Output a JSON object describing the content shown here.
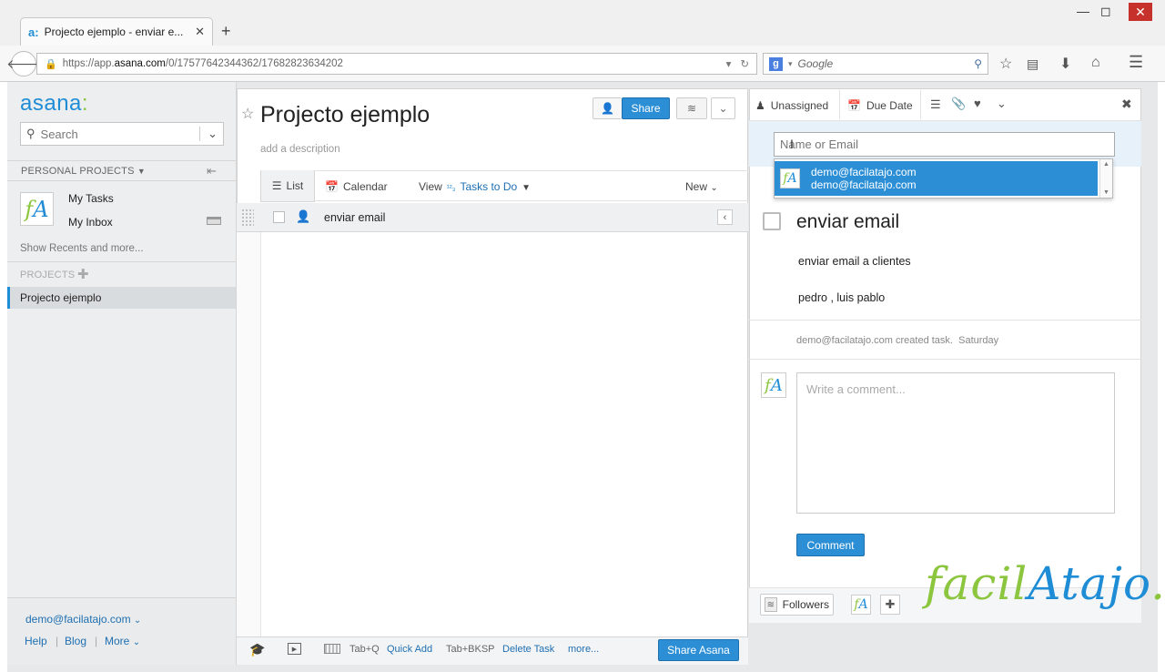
{
  "browser": {
    "tab_title": "Projecto ejemplo - enviar e...",
    "tab_favicon": "a:",
    "url_prefix": "https://app.",
    "url_domain": "asana.com",
    "url_path": "/0/17577642344362/17682823634202",
    "search_engine_placeholder": "Google",
    "new_tab_label": "+",
    "close_tab_label": "✕"
  },
  "sidebar": {
    "logo_text": "asana",
    "logo_dots": ":",
    "search_placeholder": "Search",
    "personal_projects_header": "PERSONAL PROJECTS",
    "avatar_initials": {
      "f": "f",
      "a": "A"
    },
    "my_tasks": "My Tasks",
    "my_inbox": "My Inbox",
    "show_recents": "Show Recents and more...",
    "projects_header": "PROJECTS",
    "project_item": "Projecto ejemplo",
    "user_email": "demo@facilatajo.com",
    "footer_links": {
      "help": "Help",
      "blog": "Blog",
      "more": "More"
    }
  },
  "center": {
    "project_title": "Projecto ejemplo",
    "add_description": "add a description",
    "share_label": "Share",
    "tabs": {
      "list": "List",
      "calendar": "Calendar"
    },
    "view_label": "View",
    "view_sort_icon": "¹²₃",
    "view_value": "Tasks to Do",
    "new_label": "New",
    "task_name": "enviar email",
    "shortcuts": {
      "quick_add_key": "Tab+Q",
      "quick_add": "Quick Add",
      "delete_key": "Tab+BKSP",
      "delete_task": "Delete Task",
      "more": "more..."
    },
    "share_asana": "Share Asana"
  },
  "detail": {
    "assignee_label": "Unassigned",
    "due_date_label": "Due Date",
    "name_input_placeholder": "Name or Email",
    "suggestion_primary": "demo@facilatajo.com",
    "suggestion_secondary": "demo@facilatajo.com",
    "task_title": "enviar email",
    "notes_line1": "enviar email a clientes",
    "notes_line2": "pedro , luis pablo",
    "created_by": "demo@facilatajo.com",
    "created_action": "created task.",
    "created_when": "Saturday",
    "comment_placeholder": "Write a comment...",
    "comment_button": "Comment",
    "followers_label": "Followers"
  },
  "watermark": {
    "part1": "facil",
    "part2": "Atajo",
    "part3": "."
  },
  "colors": {
    "accent": "#2c8fd6",
    "brand_green": "#8cc63f"
  }
}
